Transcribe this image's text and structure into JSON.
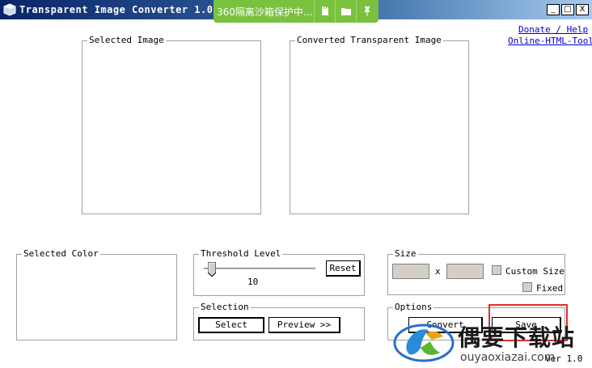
{
  "window": {
    "title": "Transparent Image Converter 1.0",
    "controls": {
      "minimize": "_",
      "maximize": "□",
      "close": "X"
    }
  },
  "sandbox_bar": {
    "text": "360隔离沙箱保护中..."
  },
  "links": {
    "donate": "Donate / Help",
    "online": "Online-HTML-Tools"
  },
  "groups": {
    "selected_image": "Selected Image",
    "converted_image": "Converted Transparent Image",
    "selected_color": "Selected Color",
    "threshold": "Threshold Level",
    "selection": "Selection",
    "size": "Size",
    "options": "Options"
  },
  "threshold": {
    "value": "10",
    "level": 10,
    "reset_label": "Reset"
  },
  "selection": {
    "select_label": "Select",
    "preview_label": "Preview >>"
  },
  "size": {
    "x_sep": "x",
    "custom_size_label": "Custom Size",
    "fixed_label": "Fixed"
  },
  "options": {
    "convert_label": "Convert",
    "save_label": "Save"
  },
  "version": "Ver 1.0",
  "watermark": {
    "title": "偶要下载站",
    "url": "ouyaoxiazai.com"
  },
  "colors": {
    "sandbox_green": "#79c13f",
    "highlight": "#e03030",
    "link": "#0000cc"
  }
}
